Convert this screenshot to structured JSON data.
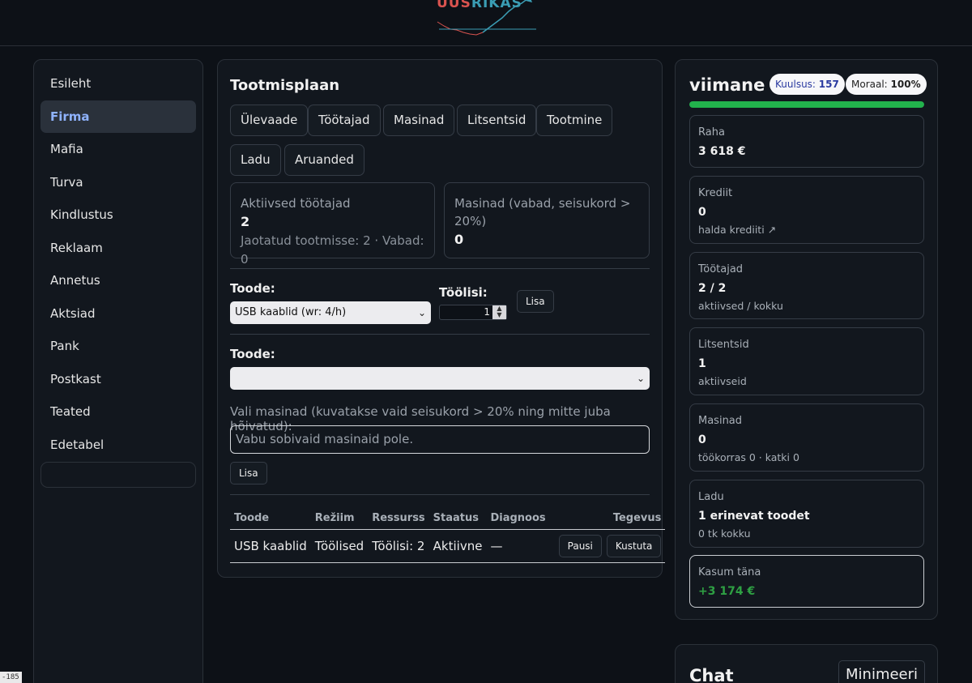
{
  "logo": {
    "part1": "UUS",
    "part2": "RIKAS"
  },
  "sidebar": {
    "items": [
      {
        "label": "Esileht"
      },
      {
        "label": "Firma",
        "active": true
      },
      {
        "label": "Mafia"
      },
      {
        "label": "Turva"
      },
      {
        "label": "Kindlustus"
      },
      {
        "label": "Reklaam"
      },
      {
        "label": "Annetus"
      },
      {
        "label": "Aktsiad"
      },
      {
        "label": "Pank"
      },
      {
        "label": "Postkast"
      },
      {
        "label": "Teated"
      },
      {
        "label": "Edetabel"
      }
    ]
  },
  "main": {
    "title": "Tootmisplaan",
    "tabs": [
      "Ülevaade",
      "Töötajad",
      "Masinad",
      "Litsentsid",
      "Tootmine",
      "Ladu",
      "Aruanded"
    ],
    "stats": {
      "workers_label": "Aktiivsed töötajad",
      "workers_value": "2",
      "workers_sub": "Jaotatud tootmisse: 2 · Vabad: 0",
      "machines_label": "Masinad (vabad, seisukord > 20%)",
      "machines_value": "0"
    },
    "form1": {
      "product_label": "Toode:",
      "product_selected": "USB kaablid (wr: 4/h)",
      "workers_label": "Töölisi:",
      "workers_value": "1",
      "add_label": "Lisa"
    },
    "form2": {
      "product_label": "Toode:",
      "product_selected": "",
      "machines_hint": "Vali masinad (kuvatakse vaid seisukord > 20% ning mitte juba hõivatud):",
      "machines_empty": "Vabu sobivaid masinaid pole.",
      "add_label": "Lisa"
    },
    "table": {
      "headers": [
        "Toode",
        "Režiim",
        "Ressurss",
        "Staatus",
        "Diagnoos",
        "Tegevus"
      ],
      "rows": [
        {
          "product": "USB kaablid",
          "mode": "Töölised",
          "resource": "Töölisi: 2",
          "status": "Aktiivne",
          "diagnosis": "—",
          "pause": "Pausi",
          "delete": "Kustuta"
        }
      ]
    }
  },
  "right": {
    "username": "viimane",
    "fame_label": "Kuulsus:",
    "fame_value": "157",
    "morale_label": "Moraal:",
    "morale_value": "100%",
    "morale_fraction": 1.0,
    "cards": {
      "money": {
        "title": "Raha",
        "value": "3 618 €"
      },
      "credit": {
        "title": "Krediit",
        "value": "0",
        "sub": "halda krediiti ↗"
      },
      "workers": {
        "title": "Töötajad",
        "value": "2 / 2",
        "sub": "aktiivsed / kokku"
      },
      "licenses": {
        "title": "Litsentsid",
        "value": "1",
        "sub": "aktiivseid"
      },
      "machines": {
        "title": "Masinad",
        "value": "0",
        "sub": "töökorras 0 · katki 0"
      },
      "stock": {
        "title": "Ladu",
        "value": "1 erinevat toodet",
        "sub": "0 tk kokku"
      },
      "profit": {
        "title": "Kasum täna",
        "value": "+3 174 €"
      }
    }
  },
  "chat": {
    "title": "Chat",
    "minimize_label": "Minimeeri"
  },
  "corner_tag": "-185",
  "colors": {
    "accent_link": "#8fb3ff",
    "morale_green": "#22b24c",
    "profit_green": "#2ea043",
    "logo_red": "#d9534f",
    "logo_teal": "#3a9db4"
  }
}
